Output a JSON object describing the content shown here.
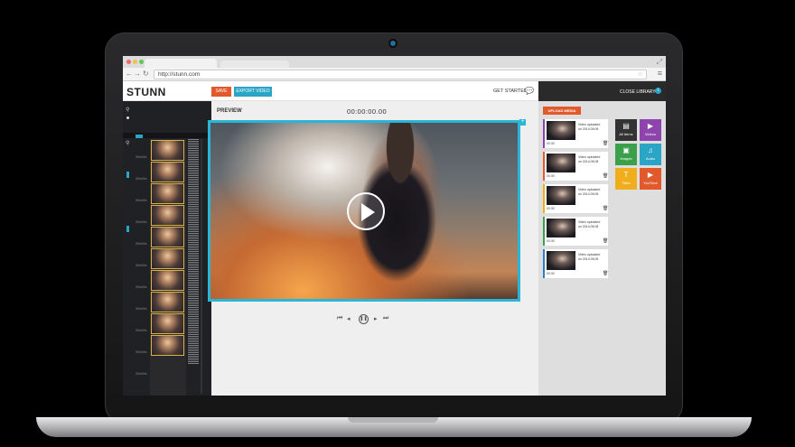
{
  "browser": {
    "url": "http://stunn.com"
  },
  "app": {
    "logo": "STUNN",
    "save_label": "SAVE",
    "export_label": "EXPORT VIDEO",
    "get_started_label": "GET STARTED",
    "close_library_label": "CLOSE LIBRARY"
  },
  "preview": {
    "label": "PREVIEW",
    "timecode": "00:00:00.00"
  },
  "timeline": {
    "duration_label": "30m00s"
  },
  "library": {
    "upload_label": "UPLOAD MEDIA",
    "cards": [
      {
        "line1": "Video uploaded",
        "line2": "on 2014.05.05",
        "time": "00:30",
        "accent": "#8e44ad"
      },
      {
        "line1": "Video uploaded",
        "line2": "on 2014.05.05",
        "time": "00:30",
        "accent": "#e25a2c"
      },
      {
        "line1": "Video uploaded",
        "line2": "on 2014.05.05",
        "time": "00:30",
        "accent": "#f0ad1c"
      },
      {
        "line1": "Video uploaded",
        "line2": "on 2014.05.05",
        "time": "00:30",
        "accent": "#3aa14a"
      },
      {
        "line1": "Video uploaded",
        "line2": "on 2014.05.05",
        "time": "00:30",
        "accent": "#2a7fc6"
      }
    ],
    "filters": [
      {
        "label": "All Items",
        "color": "#333333",
        "icon": "grid-icon",
        "glyph": "▤"
      },
      {
        "label": "Videos",
        "color": "#8e44ad",
        "icon": "videos-icon",
        "glyph": "▶"
      },
      {
        "label": "Images",
        "color": "#3aa14a",
        "icon": "images-icon",
        "glyph": "▣"
      },
      {
        "label": "Audio",
        "color": "#2aa5c6",
        "icon": "audio-icon",
        "glyph": "♫"
      },
      {
        "label": "Titles",
        "color": "#f0ad1c",
        "icon": "titles-icon",
        "glyph": "T"
      },
      {
        "label": "YouTube",
        "color": "#e25a2c",
        "icon": "youtube-icon",
        "glyph": "▶"
      }
    ]
  }
}
